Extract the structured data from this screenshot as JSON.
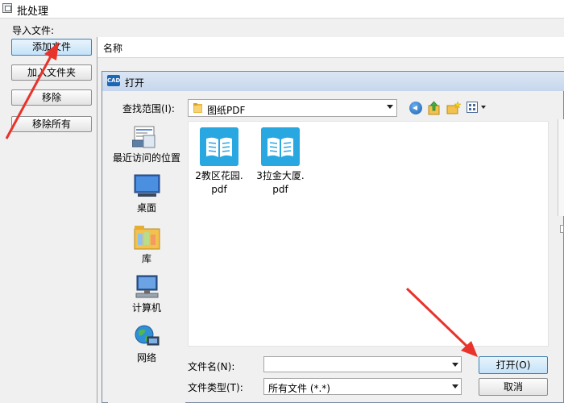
{
  "window": {
    "title": "批处理"
  },
  "import": {
    "label": "导入文件:"
  },
  "buttons": {
    "add_file": "添加文件",
    "add_folder": "加入文件夹",
    "remove": "移除",
    "remove_all": "移除所有"
  },
  "list": {
    "name_header": "名称"
  },
  "dialog": {
    "title": "打开",
    "icon_text": "CAD",
    "look_in_label": "查找范围(I):",
    "look_in_value": "图纸PDF",
    "places": [
      "最近访问的位置",
      "桌面",
      "库",
      "计算机",
      "网络"
    ],
    "files": [
      "2教区花园.\npdf",
      "3拉金大厦.\npdf"
    ],
    "filename_label": "文件名(N):",
    "filename_value": "",
    "filetype_label": "文件类型(T):",
    "filetype_value": "所有文件 (*.*)",
    "open_button": "打开(O)",
    "cancel_button": "取消"
  },
  "colors": {
    "accent": "#3c7fb1",
    "file_icon": "#29a7e1",
    "annotation": "#e8332b"
  }
}
